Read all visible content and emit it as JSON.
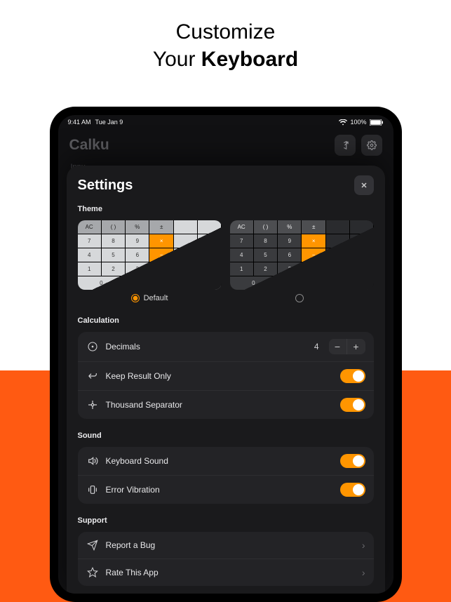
{
  "hero": {
    "line1": "Customize",
    "line2_prefix": "Your ",
    "line2_bold": "Keyboard"
  },
  "status_bar": {
    "time": "9:41 AM",
    "date": "Tue Jan 9",
    "battery": "100%"
  },
  "app": {
    "title": "Calku",
    "input_hint": "Inpu"
  },
  "modal": {
    "title": "Settings"
  },
  "sections": {
    "theme": {
      "label": "Theme",
      "options": [
        "Default",
        ""
      ],
      "selected_index": 0
    },
    "calculation": {
      "label": "Calculation",
      "decimals": {
        "label": "Decimals",
        "value": 4
      },
      "keep_result": {
        "label": "Keep Result Only",
        "on": true
      },
      "thousand_sep": {
        "label": "Thousand Separator",
        "on": true
      }
    },
    "sound": {
      "label": "Sound",
      "keyboard_sound": {
        "label": "Keyboard Sound",
        "on": true
      },
      "error_vibration": {
        "label": "Error Vibration",
        "on": true
      }
    },
    "support": {
      "label": "Support",
      "report_bug": {
        "label": "Report a Bug"
      },
      "rate_app": {
        "label": "Rate This App"
      }
    }
  },
  "keypad_rows": [
    [
      "AC",
      "( )",
      "%",
      "±",
      "",
      ""
    ],
    [
      "7",
      "8",
      "9",
      "×",
      "",
      ""
    ],
    [
      "4",
      "5",
      "6",
      "−",
      "",
      "="
    ],
    [
      "1",
      "2",
      "3",
      "+",
      "",
      ""
    ],
    [
      "0",
      "0",
      ".",
      "",
      "⌫",
      ""
    ]
  ],
  "colors": {
    "accent": "#ff9500",
    "brand_orange": "#ff5a12"
  }
}
